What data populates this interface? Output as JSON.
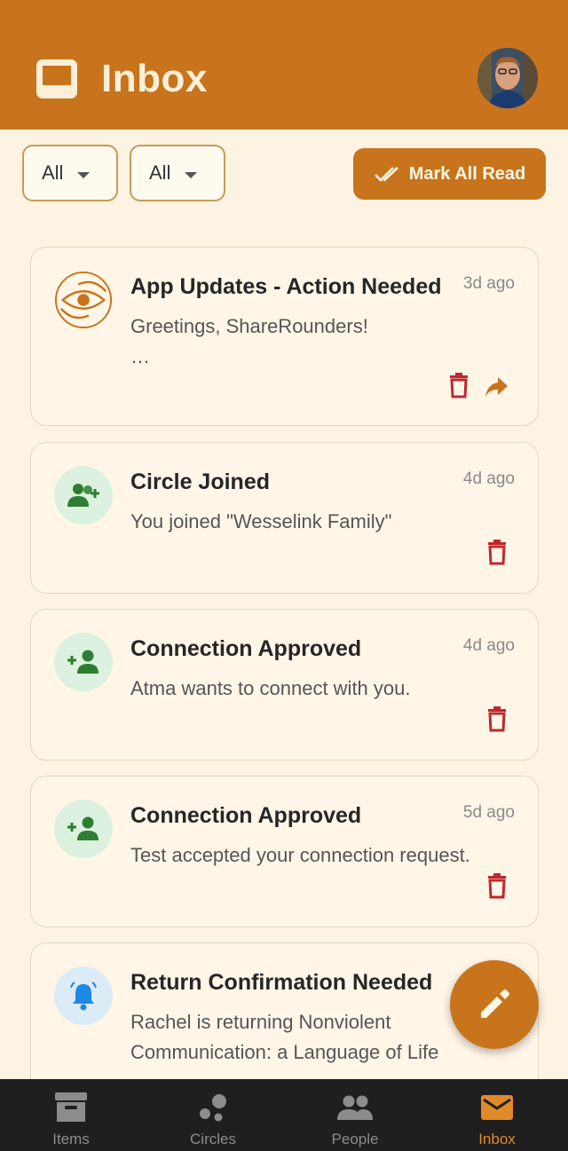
{
  "header": {
    "title": "Inbox",
    "logo_icon": "inbox-tray-icon",
    "avatar_icon": "user-avatar"
  },
  "filters": [
    {
      "label": "All"
    },
    {
      "label": "All"
    }
  ],
  "mark_all_read": {
    "label": "Mark All Read",
    "icon": "double-check-icon"
  },
  "notifications": [
    {
      "title": "App Updates - Action Needed",
      "time": "3d ago",
      "line1": "Greetings, ShareRounders!",
      "line2": "…",
      "icon": "sharerounders-logo-icon",
      "actions": [
        "delete-icon",
        "forward-icon"
      ]
    },
    {
      "title": "Circle Joined",
      "time": "4d ago",
      "line1": "You joined \"Wesselink Family\"",
      "icon": "group-add-icon",
      "actions": [
        "delete-icon"
      ]
    },
    {
      "title": "Connection Approved",
      "time": "4d ago",
      "line1": "Atma wants to connect with you.",
      "icon": "person-add-icon",
      "actions": [
        "delete-icon"
      ]
    },
    {
      "title": "Connection Approved",
      "time": "5d ago",
      "line1": "Test accepted your connection request.",
      "icon": "person-add-icon",
      "actions": [
        "delete-icon"
      ]
    },
    {
      "title": "Return Confirmation Needed",
      "line1": "Rachel is returning Nonviolent",
      "line2": "Communication: a Language of Life",
      "icon": "bell-icon"
    }
  ],
  "fab": {
    "icon": "pencil-icon"
  },
  "nav": [
    {
      "label": "Items",
      "icon": "archive-box-icon",
      "active": false
    },
    {
      "label": "Circles",
      "icon": "circles-icon",
      "active": false
    },
    {
      "label": "People",
      "icon": "people-icon",
      "active": false
    },
    {
      "label": "Inbox",
      "icon": "mail-icon",
      "active": true
    }
  ],
  "colors": {
    "primary": "#c8741c",
    "background": "#fdf3e2",
    "delete": "#c0282d",
    "success": "#2e7d32",
    "info": "#1e88e5"
  }
}
